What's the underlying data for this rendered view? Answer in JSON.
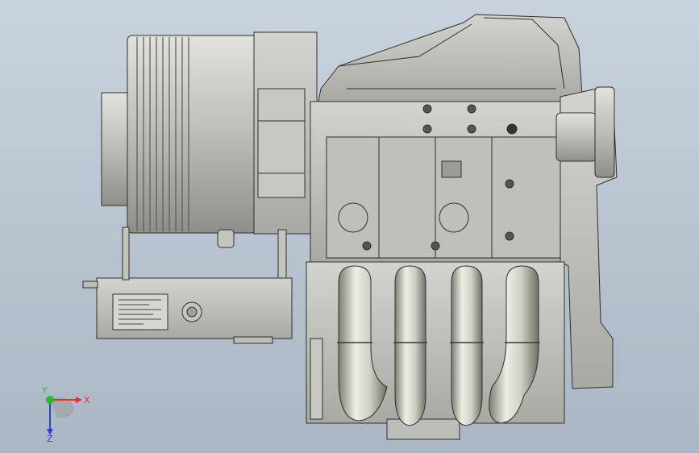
{
  "viewport": {
    "background_top": "#c9d3dd",
    "background_bottom": "#aab7c4"
  },
  "model": {
    "part_fill": "#b9b9b3",
    "part_light": "#d2d2cc",
    "part_dark": "#8a8a84",
    "edge_color": "#2e2e2e",
    "exhaust_light": "#e6e6dc",
    "exhaust_dark": "#7d7d74"
  },
  "triad": {
    "x_label": "X",
    "y_label": "Y",
    "z_label": "Z",
    "x_color": "#e03030",
    "y_color": "#22c022",
    "z_color": "#2f3fd0",
    "origin_color": "#9a9a9a"
  }
}
